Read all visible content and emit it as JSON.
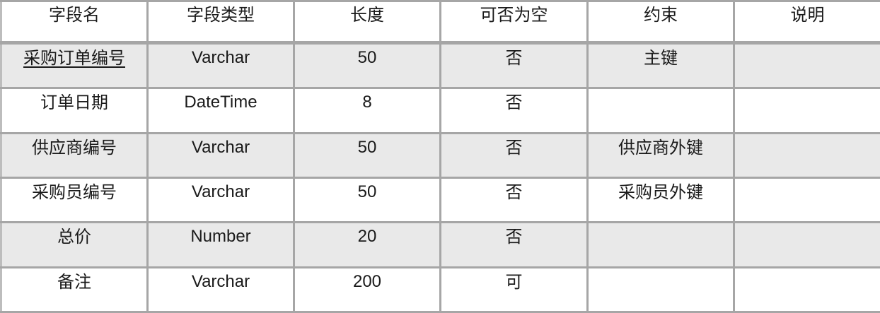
{
  "table": {
    "headers": {
      "field_name": "字段名",
      "field_type": "字段类型",
      "length": "长度",
      "nullable": "可否为空",
      "constraint": "约束",
      "description": "说明"
    },
    "rows": [
      {
        "field_name": "采购订单编号",
        "field_type": "Varchar",
        "length": "50",
        "nullable": "否",
        "constraint": "主键",
        "description": "",
        "primary_key": true,
        "shaded": true
      },
      {
        "field_name": "订单日期",
        "field_type": "DateTime",
        "length": "8",
        "nullable": "否",
        "constraint": "",
        "description": "",
        "primary_key": false,
        "shaded": false
      },
      {
        "field_name": "供应商编号",
        "field_type": "Varchar",
        "length": "50",
        "nullable": "否",
        "constraint": "供应商外键",
        "description": "",
        "primary_key": false,
        "shaded": true
      },
      {
        "field_name": "采购员编号",
        "field_type": "Varchar",
        "length": "50",
        "nullable": "否",
        "constraint": "采购员外键",
        "description": "",
        "primary_key": false,
        "shaded": false
      },
      {
        "field_name": "总价",
        "field_type": "Number",
        "length": "20",
        "nullable": "否",
        "constraint": "",
        "description": "",
        "primary_key": false,
        "shaded": true
      },
      {
        "field_name": "备注",
        "field_type": "Varchar",
        "length": "200",
        "nullable": "可",
        "constraint": "",
        "description": "",
        "primary_key": false,
        "shaded": false
      }
    ]
  },
  "colors": {
    "border": "#a6a6a6",
    "shaded_row": "#e9e9e9",
    "plain_row": "#ffffff",
    "text": "#1a1a1a"
  }
}
